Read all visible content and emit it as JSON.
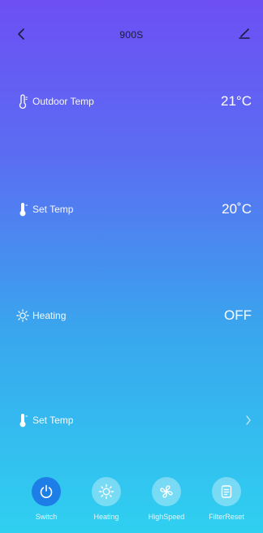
{
  "header": {
    "title": "900S",
    "back_icon": "chevron-left-icon",
    "edit_icon": "pencil-icon"
  },
  "rows": [
    {
      "icon": "thermometer-outline-icon",
      "label": "Outdoor Temp",
      "value": "21°C"
    },
    {
      "icon": "thermometer-icon",
      "label": "Set Temp",
      "value": "20˚C"
    },
    {
      "icon": "sun-icon",
      "label": "Heating",
      "value": "OFF"
    },
    {
      "icon": "thermometer-icon",
      "label": "Set Temp",
      "chevron_icon": "chevron-right-icon"
    }
  ],
  "bottom_tabs": [
    {
      "label": "Switch",
      "icon": "power-icon",
      "active": true
    },
    {
      "label": "Heating",
      "icon": "sun-icon",
      "active": false
    },
    {
      "label": "HighSpeed",
      "icon": "fan-icon",
      "active": false
    },
    {
      "label": "FilterReset",
      "icon": "document-icon",
      "active": false
    }
  ],
  "colors": {
    "gradient_top": "#6d4ff4",
    "gradient_bottom": "#2fd0f0",
    "active_tab": "#1e7ee8"
  }
}
